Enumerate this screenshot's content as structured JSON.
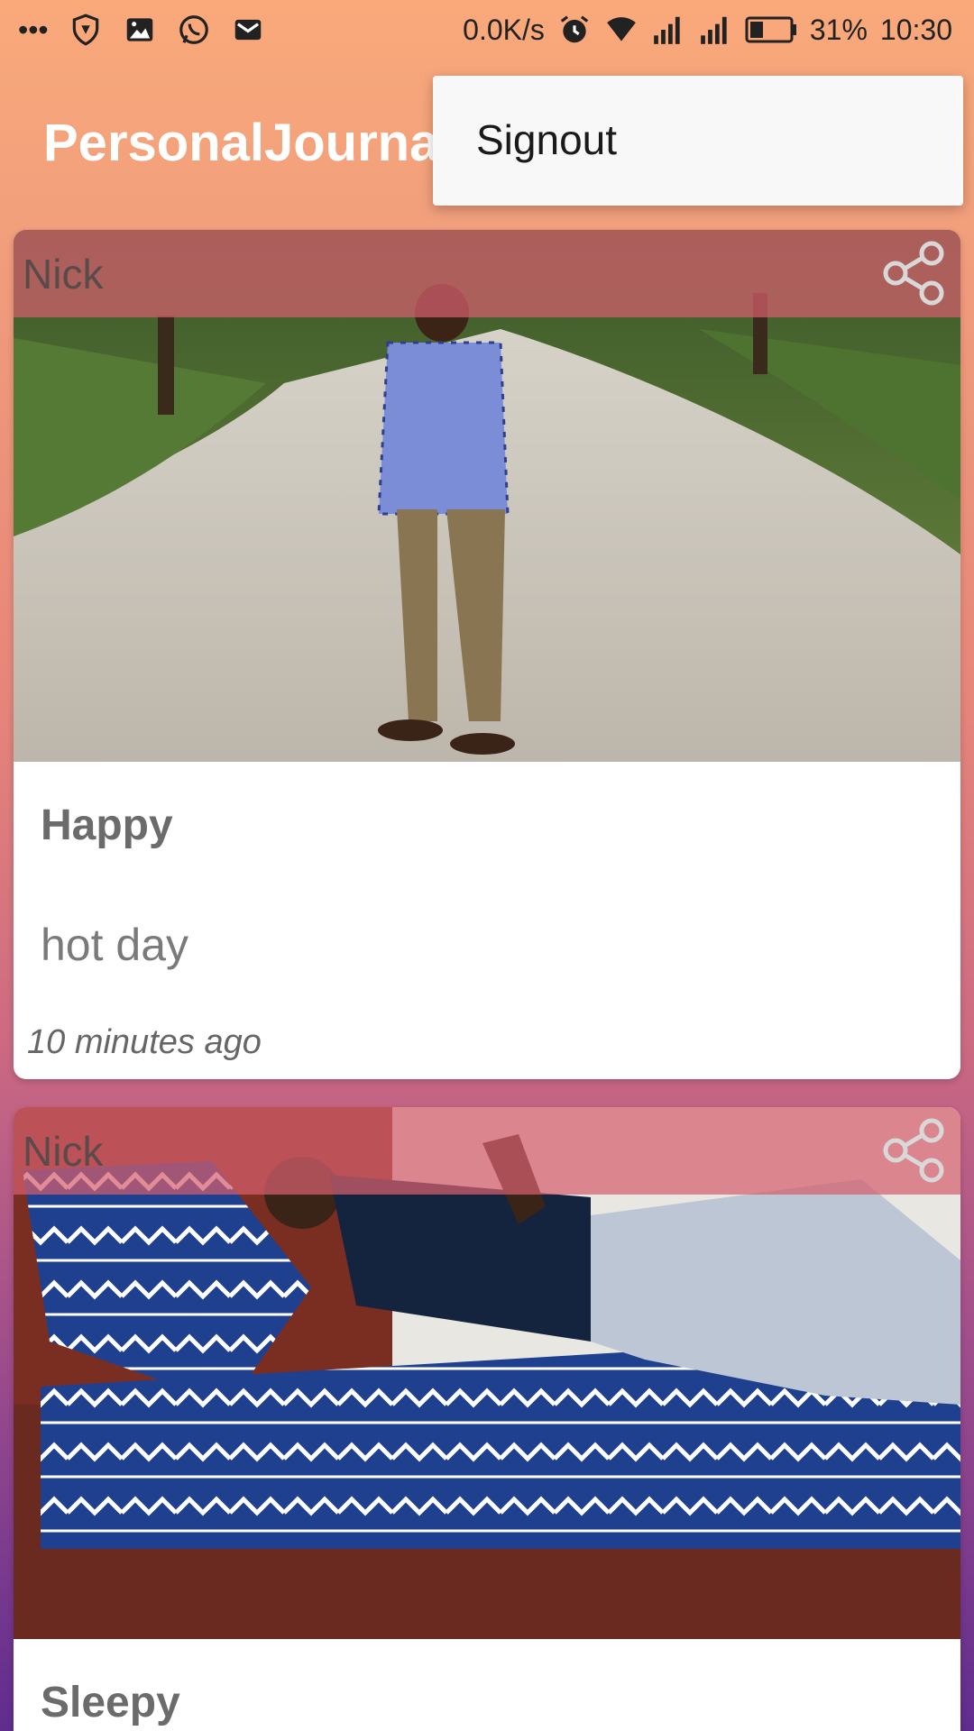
{
  "status_bar": {
    "more": "•••",
    "network_speed": "0.0K/s",
    "battery": "31%",
    "time": "10:30"
  },
  "app_bar": {
    "title": "PersonalJournal"
  },
  "menu": {
    "items": [
      {
        "label": "Signout"
      }
    ]
  },
  "entries": [
    {
      "author": "Nick",
      "title": "Happy",
      "body": "hot day",
      "time": "10 minutes ago"
    },
    {
      "author": "Nick",
      "title": "Sleepy"
    }
  ],
  "colors": {
    "header_overlay": "#d6606e",
    "title_text": "#ffffff",
    "menu_bg": "#f8f8f8"
  }
}
